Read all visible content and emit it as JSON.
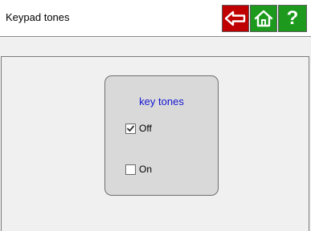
{
  "header": {
    "title": "Keypad tones",
    "buttons": {
      "back": {
        "icon": "back-arrow-icon",
        "color": "#c00000"
      },
      "home": {
        "icon": "home-icon",
        "color": "#1d9a1d"
      },
      "help": {
        "icon": "help-icon",
        "label": "?",
        "color": "#1d9a1d"
      }
    }
  },
  "panel": {
    "title": "key tones",
    "title_color": "#1515d4",
    "options": [
      {
        "label": "Off",
        "checked": true
      },
      {
        "label": "On",
        "checked": false
      }
    ]
  }
}
